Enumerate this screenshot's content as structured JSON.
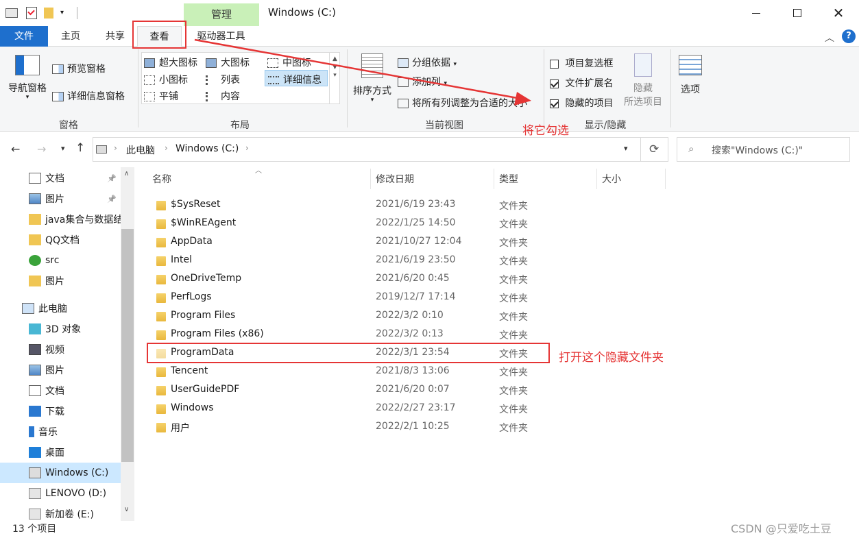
{
  "window": {
    "title": "Windows (C:)",
    "context_tab": "管理"
  },
  "tabs": {
    "file": "文件",
    "home": "主页",
    "share": "共享",
    "view": "查看",
    "drive_tools": "驱动器工具"
  },
  "ribbon": {
    "panes": {
      "nav_pane": "导航窗格",
      "preview_pane": "预览窗格",
      "details_pane": "详细信息窗格",
      "label": "窗格"
    },
    "layout": {
      "extra_large": "超大图标",
      "large": "大图标",
      "medium": "中图标",
      "small": "小图标",
      "list": "列表",
      "details": "详细信息",
      "tiles": "平铺",
      "content": "内容",
      "label": "布局"
    },
    "current_view": {
      "sort_by": "排序方式",
      "group_by": "分组依据",
      "add_columns": "添加列",
      "fit_columns": "将所有列调整为合适的大小",
      "label": "当前视图"
    },
    "show_hide": {
      "item_checkboxes": "项目复选框",
      "file_extensions": "文件扩展名",
      "hidden_items": "隐藏的项目",
      "hide_selected_1": "隐藏",
      "hide_selected_2": "所选项目",
      "label": "显示/隐藏",
      "item_checkboxes_checked": false,
      "file_extensions_checked": true,
      "hidden_items_checked": true
    },
    "options": "选项"
  },
  "address": {
    "crumb_1": "此电脑",
    "crumb_2": "Windows (C:)",
    "search_placeholder": "搜索\"Windows (C:)\""
  },
  "nav": {
    "items": [
      "文档",
      "图片",
      "java集合与数据结",
      "QQ文档",
      "src",
      "图片",
      "此电脑",
      "3D 对象",
      "视频",
      "图片",
      "文档",
      "下载",
      "音乐",
      "桌面",
      "Windows (C:)",
      "LENOVO (D:)",
      "新加卷 (E:)"
    ]
  },
  "columns": {
    "name": "名称",
    "modified": "修改日期",
    "type": "类型",
    "size": "大小"
  },
  "files": [
    {
      "name": "$SysReset",
      "date": "2021/6/19 23:43",
      "type": "文件夹"
    },
    {
      "name": "$WinREAgent",
      "date": "2022/1/25 14:50",
      "type": "文件夹"
    },
    {
      "name": "AppData",
      "date": "2021/10/27 12:04",
      "type": "文件夹"
    },
    {
      "name": "Intel",
      "date": "2021/6/19 23:50",
      "type": "文件夹"
    },
    {
      "name": "OneDriveTemp",
      "date": "2021/6/20 0:45",
      "type": "文件夹"
    },
    {
      "name": "PerfLogs",
      "date": "2019/12/7 17:14",
      "type": "文件夹"
    },
    {
      "name": "Program Files",
      "date": "2022/3/2 0:10",
      "type": "文件夹"
    },
    {
      "name": "Program Files (x86)",
      "date": "2022/3/2 0:13",
      "type": "文件夹"
    },
    {
      "name": "ProgramData",
      "date": "2022/3/1 23:54",
      "type": "文件夹"
    },
    {
      "name": "Tencent",
      "date": "2021/8/3 13:06",
      "type": "文件夹"
    },
    {
      "name": "UserGuidePDF",
      "date": "2021/6/20 0:07",
      "type": "文件夹"
    },
    {
      "name": "Windows",
      "date": "2022/2/27 23:17",
      "type": "文件夹"
    },
    {
      "name": "用户",
      "date": "2022/2/1 10:25",
      "type": "文件夹"
    }
  ],
  "status": {
    "count": "13 个项目"
  },
  "annotations": {
    "check_it": "将它勾选",
    "open_hidden": "打开这个隐藏文件夹"
  },
  "watermark": "CSDN @只爱吃土豆",
  "colors": {
    "accent": "#1e6fcd",
    "context_tab": "#c9f0b8",
    "annotation": "#e53535",
    "folder": "#f0c654"
  }
}
